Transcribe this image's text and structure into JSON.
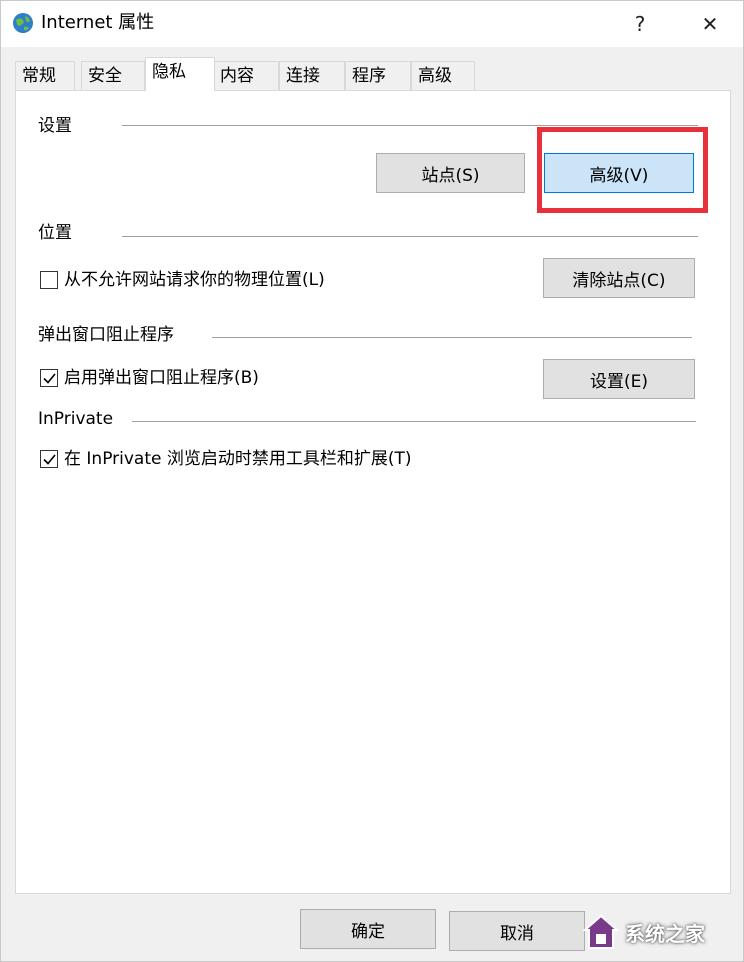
{
  "window": {
    "title": "Internet 属性",
    "help_glyph": "?",
    "close_glyph": "✕"
  },
  "tabs": [
    {
      "label": "常规",
      "active": false
    },
    {
      "label": "安全",
      "active": false
    },
    {
      "label": "隐私",
      "active": true
    },
    {
      "label": "内容",
      "active": false
    },
    {
      "label": "连接",
      "active": false
    },
    {
      "label": "程序",
      "active": false
    },
    {
      "label": "高级",
      "active": false
    }
  ],
  "settings": {
    "title": "设置",
    "sites_button": "站点(S)",
    "advanced_button": "高级(V)"
  },
  "location": {
    "title": "位置",
    "never_allow_label": "从不允许网站请求你的物理位置(L)",
    "never_allow_checked": false,
    "clear_sites_button": "清除站点(C)"
  },
  "popup": {
    "title": "弹出窗口阻止程序",
    "enable_label": "启用弹出窗口阻止程序(B)",
    "enable_checked": true,
    "settings_button": "设置(E)"
  },
  "inprivate": {
    "title": "InPrivate",
    "disable_toolbars_label": "在 InPrivate 浏览启动时禁用工具栏和扩展(T)",
    "disable_toolbars_checked": true
  },
  "footer": {
    "ok_button": "确定",
    "cancel_button": "取消"
  },
  "watermark": {
    "text": "系统之家"
  },
  "colors": {
    "highlight": "#e8303a",
    "focused_button": "#cce4f7",
    "focused_border": "#0078d7"
  }
}
